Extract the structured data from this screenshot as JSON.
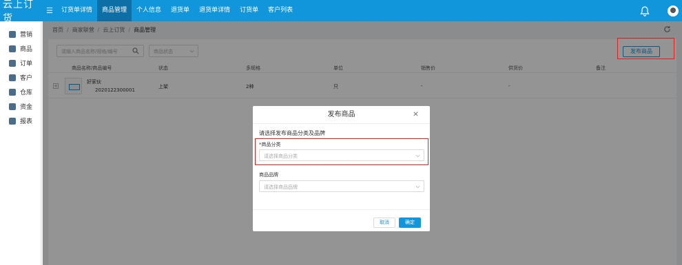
{
  "app": {
    "brand": "云上订货"
  },
  "nav": {
    "tabs": [
      {
        "label": "订货单详情",
        "active": false
      },
      {
        "label": "商品管理",
        "active": true
      },
      {
        "label": "个人信息",
        "active": false
      },
      {
        "label": "退货单",
        "active": false
      },
      {
        "label": "退货单详情",
        "active": false
      },
      {
        "label": "订货单",
        "active": false
      },
      {
        "label": "客户列表",
        "active": false
      }
    ]
  },
  "sidebar": {
    "items": [
      {
        "label": "营销",
        "icon": "marketing-icon"
      },
      {
        "label": "商品",
        "icon": "goods-icon"
      },
      {
        "label": "订单",
        "icon": "order-icon"
      },
      {
        "label": "客户",
        "icon": "customer-icon"
      },
      {
        "label": "仓库",
        "icon": "warehouse-icon"
      },
      {
        "label": "资金",
        "icon": "funds-icon"
      },
      {
        "label": "报表",
        "icon": "report-icon"
      }
    ]
  },
  "breadcrumb": [
    "首页",
    "商家联营",
    "云上订货",
    "商品管理"
  ],
  "filters": {
    "search_placeholder": "请输入商品名称/规格/编号",
    "status_placeholder": "商品状态",
    "publish_label": "发布商品"
  },
  "table": {
    "headers": [
      "商品名称/商品编号",
      "状态",
      "多规格",
      "单位",
      "销售价",
      "供货价",
      "备注"
    ],
    "rows": [
      {
        "name": "好家伙",
        "code": "2020122300001",
        "status": "上架",
        "specs": "2种",
        "unit": "只",
        "sale_price": "-",
        "supply_price": "-",
        "remark": ""
      }
    ]
  },
  "modal": {
    "title": "发布商品",
    "subtitle": "请选择发布商品分类及品牌",
    "category_label": "*商品分类",
    "category_placeholder": "请选择商品分类",
    "brand_label": "商品品牌",
    "brand_placeholder": "请选择商品品牌",
    "cancel_label": "取消",
    "ok_label": "确定"
  },
  "colors": {
    "primary": "#1296db",
    "highlight": "#e02020"
  }
}
